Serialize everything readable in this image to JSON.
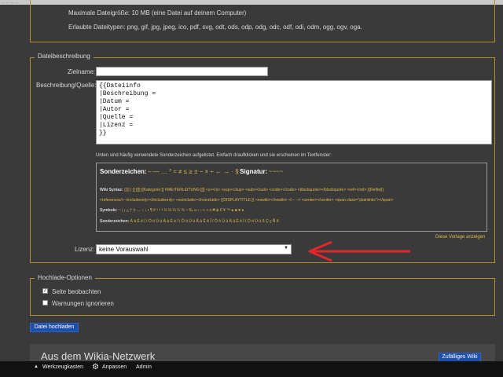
{
  "browser": {
    "title_fragment": "... ... ... ..."
  },
  "upload_info": {
    "max_size": "Maximale Dateigröße: 10 MB (eine Datei auf deinem Computer)",
    "allowed_types": "Erlaubte Dateitypen: png, gif, jpg, jpeg, ico, pdf, svg, odt, ods, odp, odg, odc, odf, odi, odm, ogg, ogv, oga."
  },
  "description": {
    "legend": "Dateibeschreibung",
    "target_label": "Zielname:",
    "target_value": "",
    "desc_label": "Beschreibung/Quelle:",
    "desc_value": "{{Dateiinfo\n|Beschreibung = \n|Datum = \n|Autor = \n|Quelle = \n|Lizenz = \n}}",
    "special_hint": "Unten sind häufig verwendete Sonderzeichen aufgelistet. Einfach draufklicken und sie erscheinen im Textfenster:"
  },
  "tools": {
    "sonderzeichen_label": "Sonderzeichen:",
    "sonderzeichen_chars": "– — … ° ≈ ≠ ≤ ≥ ± − × ÷ ← → · §",
    "signatur_label": "Signatur:",
    "signatur_value": "~~~~",
    "wiki_syntax_label": "Wiki Syntax:",
    "wiki_syntax_1": "{{}}  |  []  [[]]  [[Kategorie:]]  #WEITERLEITUNG [[]]  <s></s>  <sup></sup>  <sub></sub>  <code></code>  <blockquote></blockquote>  <ref></ref>  {{Reflist}}",
    "wiki_syntax_2": "<references/>  <includeonly></includeonly>  <noinclude></noinclude>  {{DISPLAYTITLE:}}  <nowiki></nowiki>  <!-- -->  <center></center>  <span class=\"plainlinks\"></span>",
    "symbols_label": "Symbole:",
    "symbols_value": "~ | ¡ ¿ † ‡ ↔ ↑ ↓ • ¶ # ¹ ² ³ ½ ⅓ ⅔ ¼ ¾ ~ ‰ ∞ ‹ › « » ¤ ₳ ฿ € ¥ ™ ♠ ♣ ♥ ♦",
    "special_chars_label": "Sonderzeichen:",
    "special_chars_value": "Á á É é Í í Ó ó Ú ú À à È è Ì ì Ò ò Ù ù Â â Ê ê Î î Ô ô Û û Ä ä Ë ë Ï ï Ö ö Ü ü ß Ç ç Ñ ñ",
    "show_template": "Diese Vorlage anzeigen"
  },
  "license": {
    "label": "Lizenz:",
    "selected": "keine Vorauswahl"
  },
  "upload_options": {
    "legend": "Hochlade-Optionen",
    "watch_label": "Seite beobachten",
    "watch_checked": true,
    "ignore_label": "Warnungen ignorieren",
    "ignore_checked": false
  },
  "upload_button": "Datei hochladen",
  "wikia": {
    "title": "Aus dem Wikia-Netzwerk",
    "random_button": "Zufälliges Wiki"
  },
  "toolbar": {
    "tools_label": "Werkzeugkasten",
    "customize_label": "Anpassen",
    "admin_label": "Admin"
  },
  "colors": {
    "accent": "#b88d2e",
    "arrow": "#e3262b",
    "button": "#1e4fa8"
  }
}
